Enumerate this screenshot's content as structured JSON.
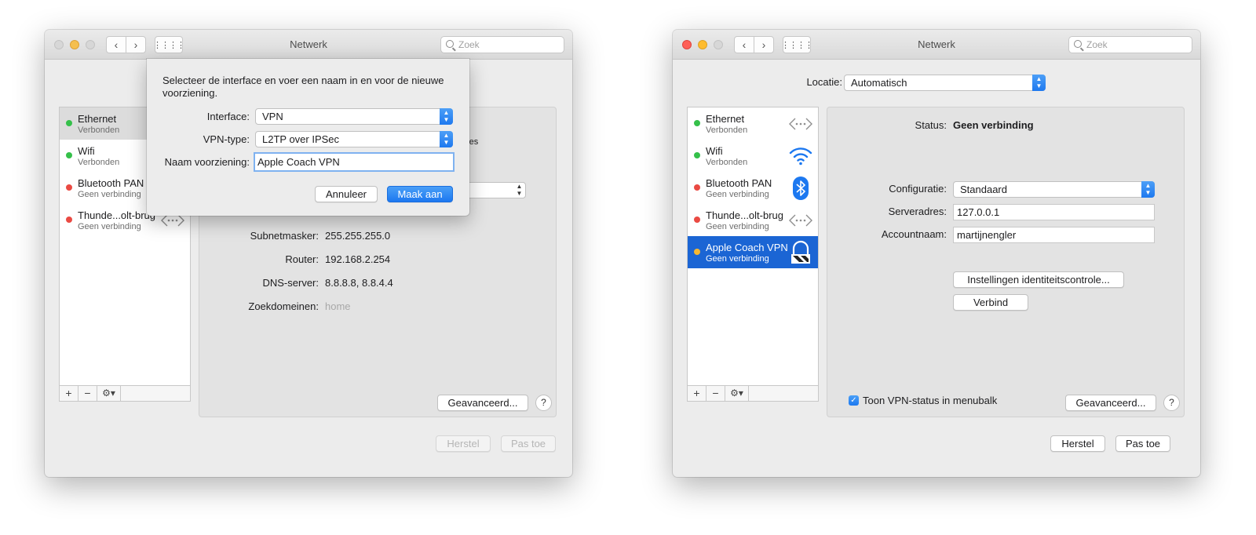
{
  "colors": {
    "accent": "#1c78f0",
    "connected": "#35c04a",
    "disconnected": "#ea4a43",
    "pending": "#f5b731"
  },
  "left_window": {
    "title": "Netwerk",
    "search_placeholder": "Zoek",
    "services": [
      {
        "name": "Ethernet",
        "status": "Verbonden",
        "status_color": "green"
      },
      {
        "name": "Wifi",
        "status": "Verbonden",
        "status_color": "green"
      },
      {
        "name": "Bluetooth PAN",
        "status": "Geen verbinding",
        "status_color": "red"
      },
      {
        "name": "Thunde...olt-brug",
        "status": "Geen verbinding",
        "status_color": "red"
      }
    ],
    "partial_text": "res",
    "details": [
      {
        "label": "Subnetmasker:",
        "value": "255.255.255.0"
      },
      {
        "label": "Router:",
        "value": "192.168.2.254"
      },
      {
        "label": "DNS-server:",
        "value": "8.8.8.8, 8.8.4.4"
      },
      {
        "label": "Zoekdomeinen:",
        "value": "home"
      }
    ],
    "advanced_label": "Geavanceerd...",
    "help_label": "?",
    "revert_label": "Herstel",
    "apply_label": "Pas toe",
    "sheet": {
      "message": "Selecteer de interface en voer een naam in en voor de nieuwe voorziening.",
      "interface_label": "Interface:",
      "interface_value": "VPN",
      "vpn_type_label": "VPN-type:",
      "vpn_type_value": "L2TP over IPSec",
      "service_name_label": "Naam voorziening:",
      "service_name_value": "Apple Coach VPN",
      "cancel_label": "Annuleer",
      "create_label": "Maak aan"
    }
  },
  "right_window": {
    "title": "Netwerk",
    "search_placeholder": "Zoek",
    "location_label": "Locatie:",
    "location_value": "Automatisch",
    "services": [
      {
        "name": "Ethernet",
        "status": "Verbonden",
        "status_color": "green",
        "icon": "ethernet-icon"
      },
      {
        "name": "Wifi",
        "status": "Verbonden",
        "status_color": "green",
        "icon": "wifi-icon"
      },
      {
        "name": "Bluetooth PAN",
        "status": "Geen verbinding",
        "status_color": "red",
        "icon": "bluetooth-icon"
      },
      {
        "name": "Thunde...olt-brug",
        "status": "Geen verbinding",
        "status_color": "red",
        "icon": "thunderbolt-bridge-icon"
      },
      {
        "name": "Apple Coach VPN",
        "status": "Geen verbinding",
        "status_color": "orange",
        "icon": "vpn-lock-icon",
        "selected": true
      }
    ],
    "status_label": "Status:",
    "status_value": "Geen verbinding",
    "config_label": "Configuratie:",
    "config_value": "Standaard",
    "server_label": "Serveradres:",
    "server_value": "127.0.0.1",
    "account_label": "Accountnaam:",
    "account_value": "martijnengler",
    "auth_settings_label": "Instellingen identiteitscontrole...",
    "connect_label": "Verbind",
    "show_vpn_status_label": "Toon VPN-status in menubalk",
    "show_vpn_status_checked": true,
    "advanced_label": "Geavanceerd...",
    "help_label": "?",
    "revert_label": "Herstel",
    "apply_label": "Pas toe"
  }
}
